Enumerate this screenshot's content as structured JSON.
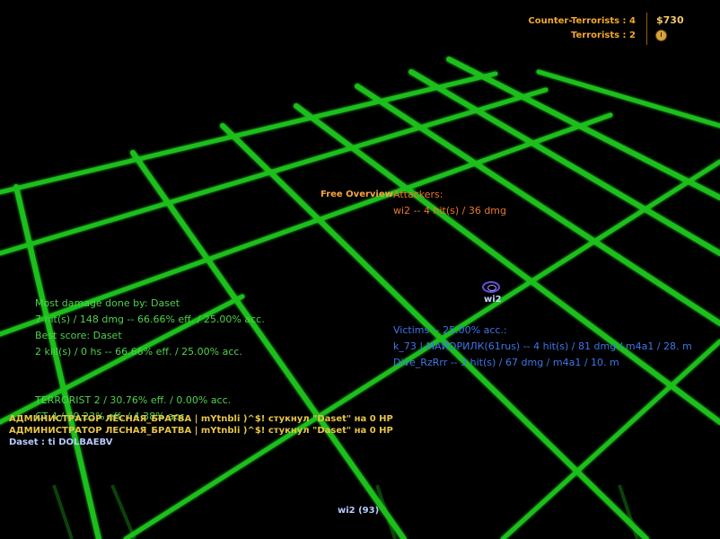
{
  "scoreboard": {
    "counter_terrorists": "Counter-Terrorists : 4",
    "terrorists": "Terrorists : 2",
    "money": "$730"
  },
  "icons": {
    "timer": "timer-icon",
    "player_marker": "player-marker-icon"
  },
  "colors": {
    "grid": "#1fbf1a",
    "hud_orange": "#f2a72e",
    "stats_green": "#4fd14b",
    "victims_blue": "#3d76e8",
    "chat_yellow": "#e6c34a"
  },
  "overview": {
    "mode": "Free Overview"
  },
  "attackers": {
    "header": "Attackers:",
    "lines": [
      "wi2 -- 4 hit(s) / 36 dmg"
    ]
  },
  "stats": {
    "lines": [
      "Most damage done by: Daset",
      "7 hit(s) / 148 dmg -- 66.66% eff. / 25.00% acc.",
      "Best score: Daset",
      "2 kill(s) / 0 hs -- 66.66% eff. / 25.00% acc."
    ]
  },
  "victims": {
    "header": "Victims -- 25.00% acc.:",
    "lines": [
      "k_73 | МАЙОРИЛК(61rus) -- 4 hit(s) / 81 dmg / m4a1 / 28. m",
      "Dive_RzRrr -- 3 hit(s) / 67 dmg / m4a1 / 10. m"
    ]
  },
  "team_stats": {
    "lines": [
      "TERRORIST 2 / 30.76% eff. / 0.00% acc.",
      "CT 4 / 69.23% eff. / 4.38% acc."
    ]
  },
  "chat": [
    {
      "text": "АДМИНИСТРАТОР ЛЕСНАЯ_БРАТВА | mYtnbli )^$! стукнул \"Daset\" на 0 HP",
      "style": "yellow"
    },
    {
      "text": "АДМИНИСТРАТОР ЛЕСНАЯ_БРАТВА | mYtnbli )^$! стукнул \"Daset\" на 0 HP",
      "style": "yellow"
    },
    {
      "text": "Daset :  ti DOLBAEBV",
      "style": "blue"
    }
  ],
  "player": {
    "name": "wi2"
  },
  "spectator": {
    "target": "wi2 (93)"
  }
}
